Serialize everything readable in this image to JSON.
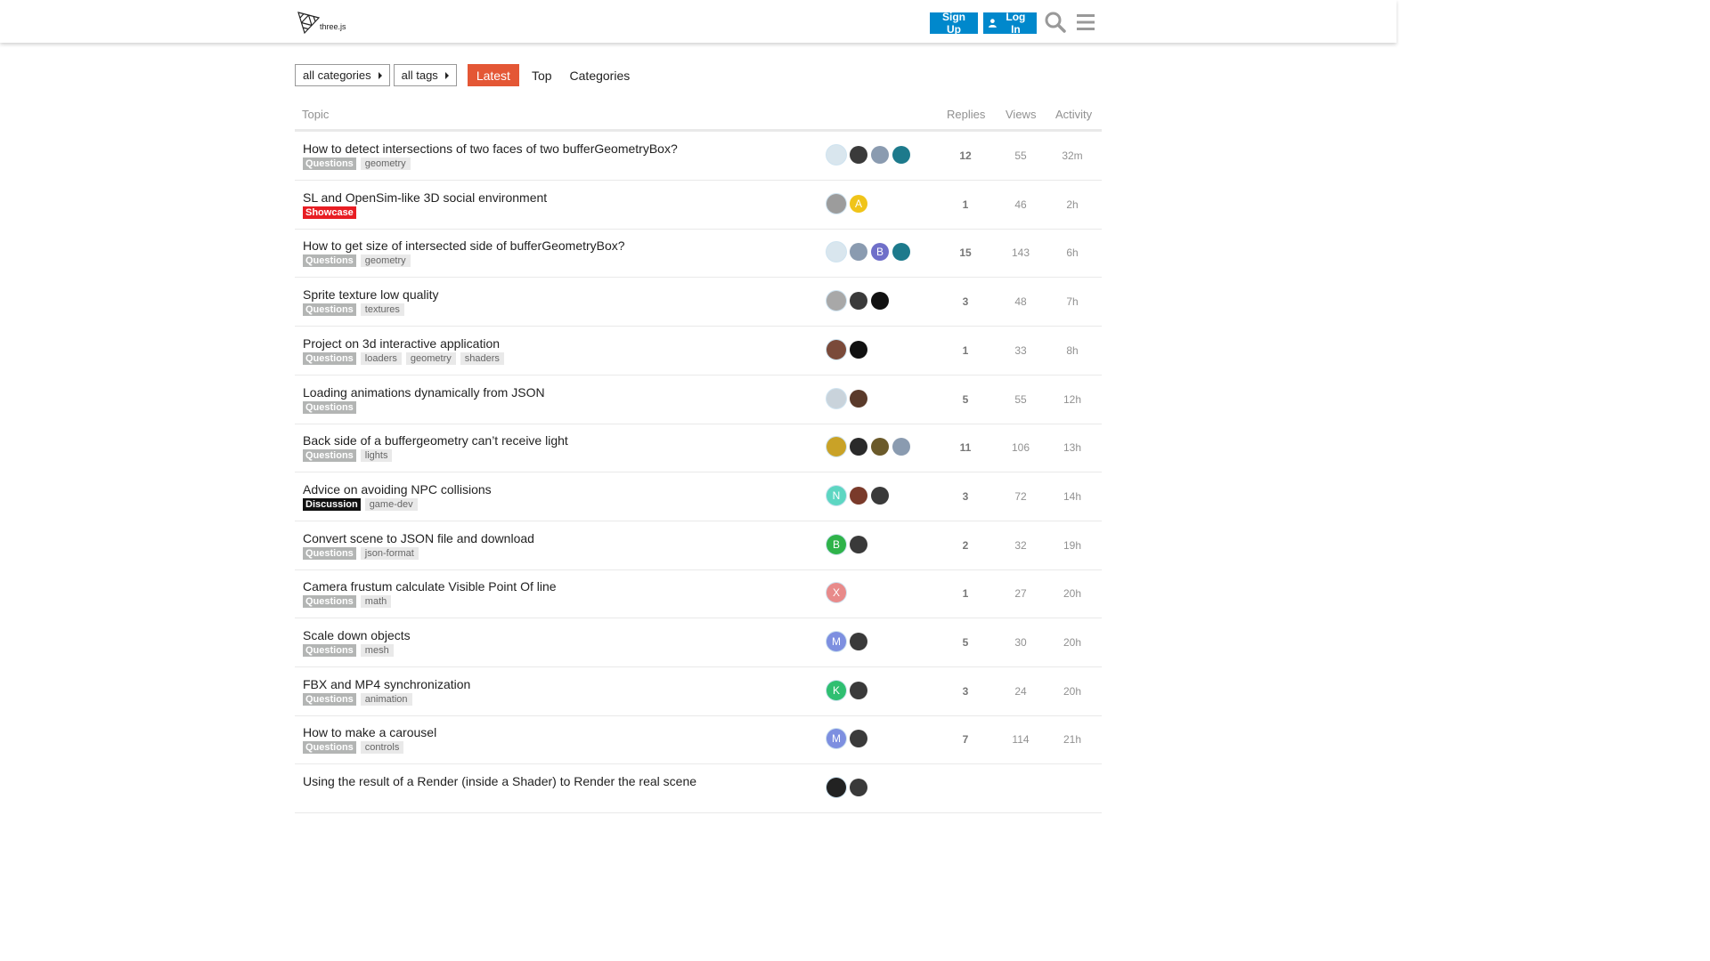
{
  "header": {
    "logo_text": "three.js",
    "signup_label": "Sign Up",
    "login_label": "Log In",
    "colors": {
      "primary": "#0088cc"
    }
  },
  "nav": {
    "categories_dropdown": "all categories",
    "tags_dropdown": "all tags",
    "tabs": [
      {
        "label": "Latest",
        "active": true
      },
      {
        "label": "Top",
        "active": false
      },
      {
        "label": "Categories",
        "active": false
      }
    ],
    "active_color": "#e45735"
  },
  "columns": {
    "topic": "Topic",
    "replies": "Replies",
    "views": "Views",
    "activity": "Activity"
  },
  "topics": [
    {
      "title": "How to detect intersections of two faces of two bufferGeometryBox?",
      "category": "Questions",
      "category_color": "#b3b5b4",
      "tags": [
        "geometry"
      ],
      "avatars": [
        {
          "bg": "#d9e6ee",
          "letter": ""
        },
        {
          "bg": "#3a3a3a",
          "letter": ""
        },
        {
          "bg": "#8a9bb0",
          "letter": ""
        },
        {
          "bg": "#1d7a8c",
          "letter": ""
        }
      ],
      "replies": "12",
      "views": "55",
      "activity": "32m"
    },
    {
      "title": "SL and OpenSim-like 3D social environment",
      "category": "Showcase",
      "category_color": "#e81d23",
      "tags": [],
      "avatars": [
        {
          "bg": "#9c9c9c",
          "letter": ""
        },
        {
          "bg": "#f0c419",
          "letter": "A"
        }
      ],
      "replies": "1",
      "views": "46",
      "activity": "2h"
    },
    {
      "title": "How to get size of intersected side of bufferGeometryBox?",
      "category": "Questions",
      "category_color": "#b3b5b4",
      "tags": [
        "geometry"
      ],
      "avatars": [
        {
          "bg": "#d9e6ee",
          "letter": ""
        },
        {
          "bg": "#8a9bb0",
          "letter": ""
        },
        {
          "bg": "#6f6fc9",
          "letter": "B"
        },
        {
          "bg": "#1d7a8c",
          "letter": ""
        }
      ],
      "replies": "15",
      "views": "143",
      "activity": "6h"
    },
    {
      "title": "Sprite texture low quality",
      "category": "Questions",
      "category_color": "#b3b5b4",
      "tags": [
        "textures"
      ],
      "avatars": [
        {
          "bg": "#a8a8a8",
          "letter": ""
        },
        {
          "bg": "#3a3a3a",
          "letter": ""
        },
        {
          "bg": "#111111",
          "letter": ""
        }
      ],
      "replies": "3",
      "views": "48",
      "activity": "7h"
    },
    {
      "title": "Project on 3d interactive application",
      "category": "Questions",
      "category_color": "#b3b5b4",
      "tags": [
        "loaders",
        "geometry",
        "shaders"
      ],
      "avatars": [
        {
          "bg": "#7a4a3a",
          "letter": ""
        },
        {
          "bg": "#111111",
          "letter": ""
        }
      ],
      "replies": "1",
      "views": "33",
      "activity": "8h"
    },
    {
      "title": "Loading animations dynamically from JSON",
      "category": "Questions",
      "category_color": "#b3b5b4",
      "tags": [],
      "avatars": [
        {
          "bg": "#c9d3db",
          "letter": ""
        },
        {
          "bg": "#5a3a2a",
          "letter": ""
        }
      ],
      "replies": "5",
      "views": "55",
      "activity": "12h"
    },
    {
      "title": "Back side of a buffergeometry can’t receive light",
      "category": "Questions",
      "category_color": "#b3b5b4",
      "tags": [
        "lights"
      ],
      "avatars": [
        {
          "bg": "#c9a227",
          "letter": ""
        },
        {
          "bg": "#2a2a2a",
          "letter": ""
        },
        {
          "bg": "#6b5a2a",
          "letter": ""
        },
        {
          "bg": "#8a9bb0",
          "letter": ""
        }
      ],
      "replies": "11",
      "views": "106",
      "activity": "13h"
    },
    {
      "title": "Advice on avoiding NPC collisions",
      "category": "Discussion",
      "category_color": "#111111",
      "tags": [
        "game-dev"
      ],
      "avatars": [
        {
          "bg": "#5dd6c2",
          "letter": "N"
        },
        {
          "bg": "#7a3a2a",
          "letter": ""
        },
        {
          "bg": "#3a3a3a",
          "letter": ""
        }
      ],
      "replies": "3",
      "views": "72",
      "activity": "14h"
    },
    {
      "title": "Convert scene to JSON file and download",
      "category": "Questions",
      "category_color": "#b3b5b4",
      "tags": [
        "json-format"
      ],
      "avatars": [
        {
          "bg": "#2fb34a",
          "letter": "B"
        },
        {
          "bg": "#3a3a3a",
          "letter": ""
        }
      ],
      "replies": "2",
      "views": "32",
      "activity": "19h"
    },
    {
      "title": "Camera frustum calculate Visible Point Of line",
      "category": "Questions",
      "category_color": "#b3b5b4",
      "tags": [
        "math"
      ],
      "avatars": [
        {
          "bg": "#e88a8a",
          "letter": "X"
        }
      ],
      "replies": "1",
      "views": "27",
      "activity": "20h"
    },
    {
      "title": "Scale down objects",
      "category": "Questions",
      "category_color": "#b3b5b4",
      "tags": [
        "mesh"
      ],
      "avatars": [
        {
          "bg": "#7d8fe0",
          "letter": "M"
        },
        {
          "bg": "#3a3a3a",
          "letter": ""
        }
      ],
      "replies": "5",
      "views": "30",
      "activity": "20h"
    },
    {
      "title": "FBX and MP4 synchronization",
      "category": "Questions",
      "category_color": "#b3b5b4",
      "tags": [
        "animation"
      ],
      "avatars": [
        {
          "bg": "#2fbf71",
          "letter": "K"
        },
        {
          "bg": "#3a3a3a",
          "letter": ""
        }
      ],
      "replies": "3",
      "views": "24",
      "activity": "20h"
    },
    {
      "title": "How to make a carousel",
      "category": "Questions",
      "category_color": "#b3b5b4",
      "tags": [
        "controls"
      ],
      "avatars": [
        {
          "bg": "#7d8fe0",
          "letter": "M"
        },
        {
          "bg": "#3a3a3a",
          "letter": ""
        }
      ],
      "replies": "7",
      "views": "114",
      "activity": "21h"
    },
    {
      "title": "Using the result of a Render (inside a Shader) to Render the real scene",
      "category": "",
      "category_color": "#b3b5b4",
      "tags": [],
      "avatars": [
        {
          "bg": "#222222",
          "letter": ""
        },
        {
          "bg": "#3a3a3a",
          "letter": ""
        }
      ],
      "replies": "",
      "views": "",
      "activity": ""
    }
  ]
}
